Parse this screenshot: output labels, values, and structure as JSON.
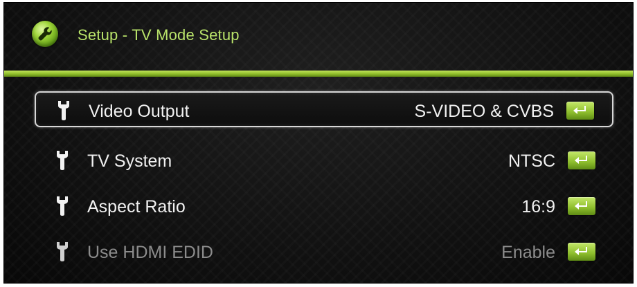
{
  "header": {
    "title": "Setup - TV Mode Setup",
    "icon": "wrench-icon",
    "accent_color": "#9fd53a"
  },
  "menu": {
    "items": [
      {
        "label": "Video Output",
        "value": "S-VIDEO & CVBS",
        "selected": true,
        "enabled": true,
        "icon": "wrench-icon",
        "action_icon": "enter-key-icon"
      },
      {
        "label": "TV System",
        "value": "NTSC",
        "selected": false,
        "enabled": true,
        "icon": "wrench-icon",
        "action_icon": "enter-key-icon"
      },
      {
        "label": "Aspect Ratio",
        "value": "16:9",
        "selected": false,
        "enabled": true,
        "icon": "wrench-icon",
        "action_icon": "enter-key-icon"
      },
      {
        "label": "Use HDMI EDID",
        "value": "Enable",
        "selected": false,
        "enabled": false,
        "icon": "wrench-icon",
        "action_icon": "enter-key-icon"
      }
    ]
  }
}
